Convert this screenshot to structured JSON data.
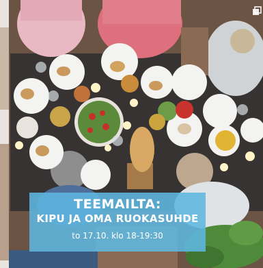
{
  "banner": {
    "title": "TEEMAILTA:",
    "subtitle": "KIPU JA OMA RUOKASUHDE",
    "date": "to 17.10. klo 18-19:30",
    "background_color": "#5eb7e0"
  },
  "photo": {
    "icons": [
      "instagram-carousel-icon"
    ]
  }
}
